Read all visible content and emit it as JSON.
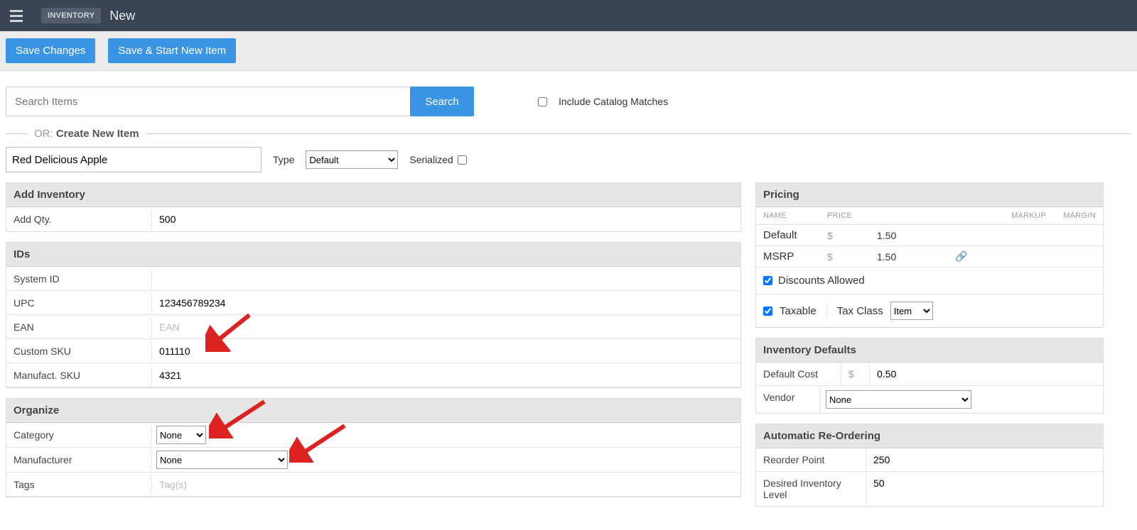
{
  "header": {
    "breadcrumb_badge": "INVENTORY",
    "breadcrumb_page": "New"
  },
  "actions": {
    "save_label": "Save Changes",
    "save_new_label": "Save & Start New Item"
  },
  "search": {
    "placeholder": "Search Items",
    "button_label": "Search",
    "include_catalog_label": "Include Catalog Matches",
    "include_catalog_checked": false
  },
  "or_separator": {
    "prefix": "OR: ",
    "strong": "Create New Item"
  },
  "new_item": {
    "name_value": "Red Delicious Apple",
    "type_label": "Type",
    "type_value": "Default",
    "serialized_label": "Serialized",
    "serialized_checked": false
  },
  "add_inventory": {
    "title": "Add Inventory",
    "qty_label": "Add Qty.",
    "qty_value": "500"
  },
  "ids": {
    "title": "IDs",
    "system_id_label": "System ID",
    "system_id_value": "",
    "upc_label": "UPC",
    "upc_value": "123456789234",
    "ean_label": "EAN",
    "ean_placeholder": "EAN",
    "ean_value": "",
    "custom_sku_label": "Custom SKU",
    "custom_sku_value": "011110",
    "manufact_sku_label": "Manufact. SKU",
    "manufact_sku_value": "4321"
  },
  "organize": {
    "title": "Organize",
    "category_label": "Category",
    "category_value": "None",
    "manufacturer_label": "Manufacturer",
    "manufacturer_value": "None",
    "tags_label": "Tags",
    "tags_placeholder": "Tag(s)",
    "tags_value": ""
  },
  "pricing": {
    "title": "Pricing",
    "columns": {
      "name": "NAME",
      "price": "PRICE",
      "markup": "MARKUP",
      "margin": "MARGIN"
    },
    "currency": "$",
    "rows": [
      {
        "name": "Default",
        "price": "1.50"
      },
      {
        "name": "MSRP",
        "price": "1.50"
      }
    ],
    "discounts_label": "Discounts Allowed",
    "discounts_checked": true,
    "taxable_label": "Taxable",
    "taxable_checked": true,
    "tax_class_label": "Tax Class",
    "tax_class_value": "Item"
  },
  "inventory_defaults": {
    "title": "Inventory Defaults",
    "default_cost_label": "Default Cost",
    "currency": "$",
    "default_cost_value": "0.50",
    "vendor_label": "Vendor",
    "vendor_value": "None"
  },
  "reorder": {
    "title": "Automatic Re-Ordering",
    "reorder_point_label": "Reorder Point",
    "reorder_point_value": "250",
    "desired_level_label": "Desired Inventory Level",
    "desired_level_value": "50"
  }
}
